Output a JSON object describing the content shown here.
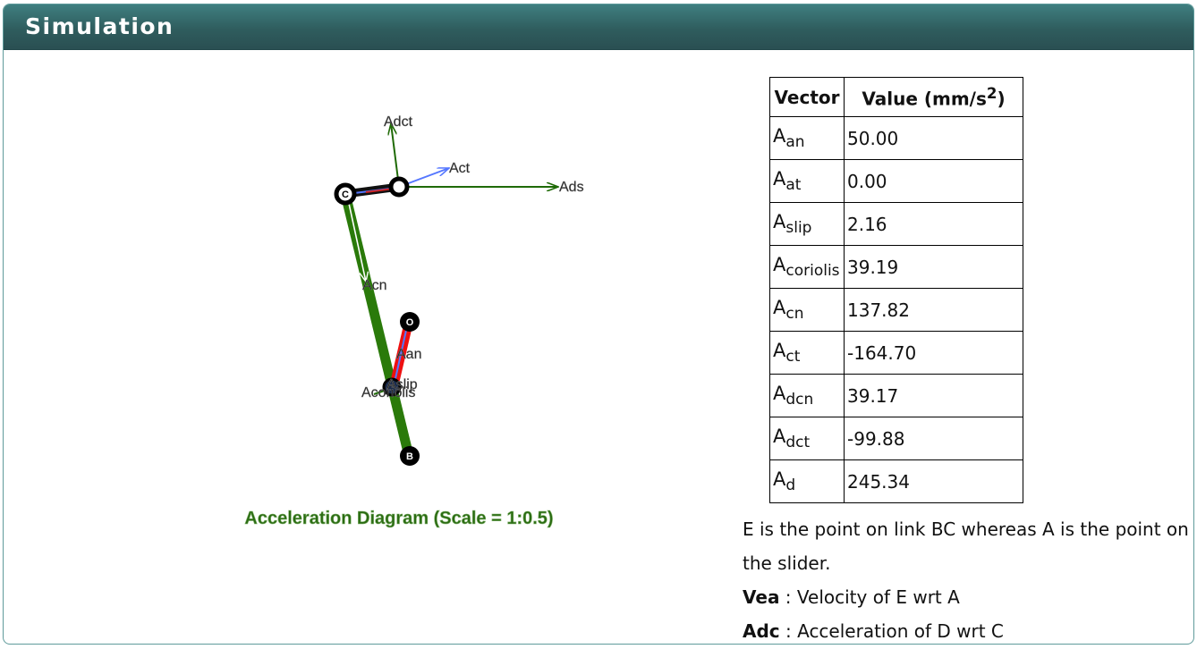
{
  "header": {
    "title": "Simulation"
  },
  "diagram": {
    "caption": "Acceleration Diagram (Scale = 1:0.5)",
    "vector_labels": [
      "Adct",
      "Act",
      "Ads",
      "Acn",
      "Aan",
      "Aslip",
      "Acoriolis"
    ],
    "joint_labels": [
      "C",
      "O",
      "B"
    ],
    "colors": {
      "link_green": "#2a7a0a",
      "link_red": "#ee1010",
      "vector_green": "#1f6a06",
      "vector_blue": "#5577ff",
      "caption": "#2a6b12"
    }
  },
  "table": {
    "headers": {
      "vector": "Vector",
      "value": "Value (mm/s",
      "value_sup": "2",
      "value_close": ")"
    },
    "rows": [
      {
        "base": "A",
        "sub": "an",
        "value": "50.00"
      },
      {
        "base": "A",
        "sub": "at",
        "value": "0.00"
      },
      {
        "base": "A",
        "sub": "slip",
        "value": "2.16"
      },
      {
        "base": "A",
        "sub": "coriolis",
        "value": "39.19"
      },
      {
        "base": "A",
        "sub": "cn",
        "value": "137.82"
      },
      {
        "base": "A",
        "sub": "ct",
        "value": "-164.70"
      },
      {
        "base": "A",
        "sub": "dcn",
        "value": "39.17"
      },
      {
        "base": "A",
        "sub": "dct",
        "value": "-99.88"
      },
      {
        "base": "A",
        "sub": "d",
        "value": "245.34"
      }
    ]
  },
  "notes": {
    "line1": "E is the point on link BC whereas A is the point on the slider.",
    "defs": [
      {
        "term": "Vea",
        "desc": " : Velocity of E wrt A"
      },
      {
        "term": "Adc",
        "desc": " : Acceleration of D wrt C"
      }
    ]
  }
}
